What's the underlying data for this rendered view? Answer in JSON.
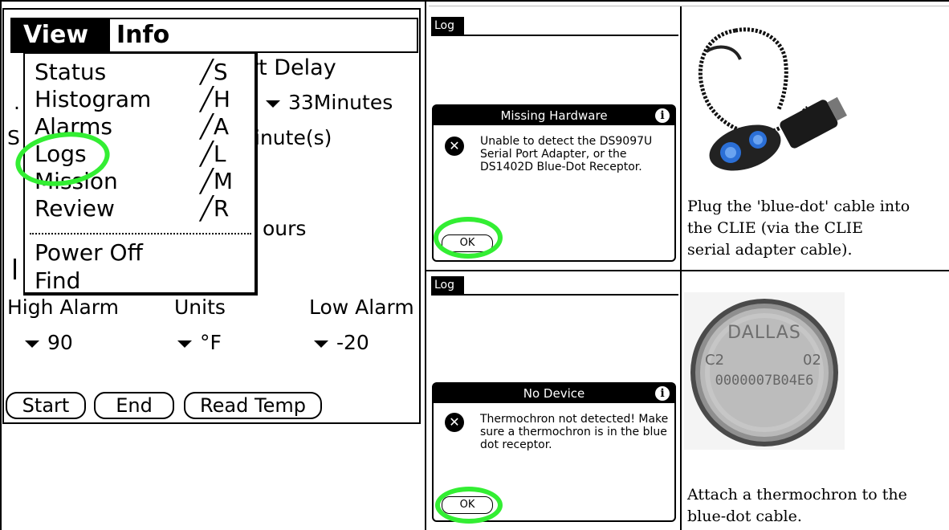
{
  "left": {
    "menu": {
      "active": "View",
      "other": "Info",
      "items": [
        {
          "label": "Status",
          "shortcut": "S"
        },
        {
          "label": "Histogram",
          "shortcut": "H"
        },
        {
          "label": "Alarms",
          "shortcut": "A"
        },
        {
          "label": "Logs",
          "shortcut": "L"
        },
        {
          "label": "Mission",
          "shortcut": "M"
        },
        {
          "label": "Review",
          "shortcut": "R"
        }
      ],
      "extra_items": [
        "Power Off",
        "Find"
      ]
    },
    "background": {
      "start_delay": "rt Delay",
      "minutes_value": "33Minutes",
      "minutes_prefix": "s",
      "interval": "inute(s)",
      "hours": "ours"
    },
    "labels": {
      "high_alarm": "High Alarm",
      "units": "Units",
      "low_alarm": "Low Alarm"
    },
    "values": {
      "high": "90",
      "units": "°F",
      "low": "-20"
    },
    "buttons": {
      "start": "Start",
      "end": "End",
      "read_temp": "Read Temp"
    }
  },
  "dialogs": {
    "top": {
      "form_title": "Log Data",
      "title": "Missing Hardware",
      "message": "Unable to detect the DS9097U Serial Port Adapter, or the DS1402D Blue-Dot Receptor.",
      "ok": "OK"
    },
    "bottom": {
      "form_title": "Log Data",
      "title": "No Device",
      "message": "Thermochron not detected! Make sure a thermochron is in the blue dot receptor.",
      "ok": "OK"
    }
  },
  "right": {
    "caption_top": [
      "Plug the 'blue-dot' cable into",
      "the CLIE (via the CLIE",
      "serial adapter cable)."
    ],
    "caption_bottom": [
      "Attach a thermochron to the",
      "blue-dot cable."
    ],
    "button_label": {
      "brand": "DALLAS",
      "left": "C2",
      "right": "02",
      "serial": "0000007B04E6"
    }
  },
  "colors": {
    "highlight": "#33ee33"
  }
}
